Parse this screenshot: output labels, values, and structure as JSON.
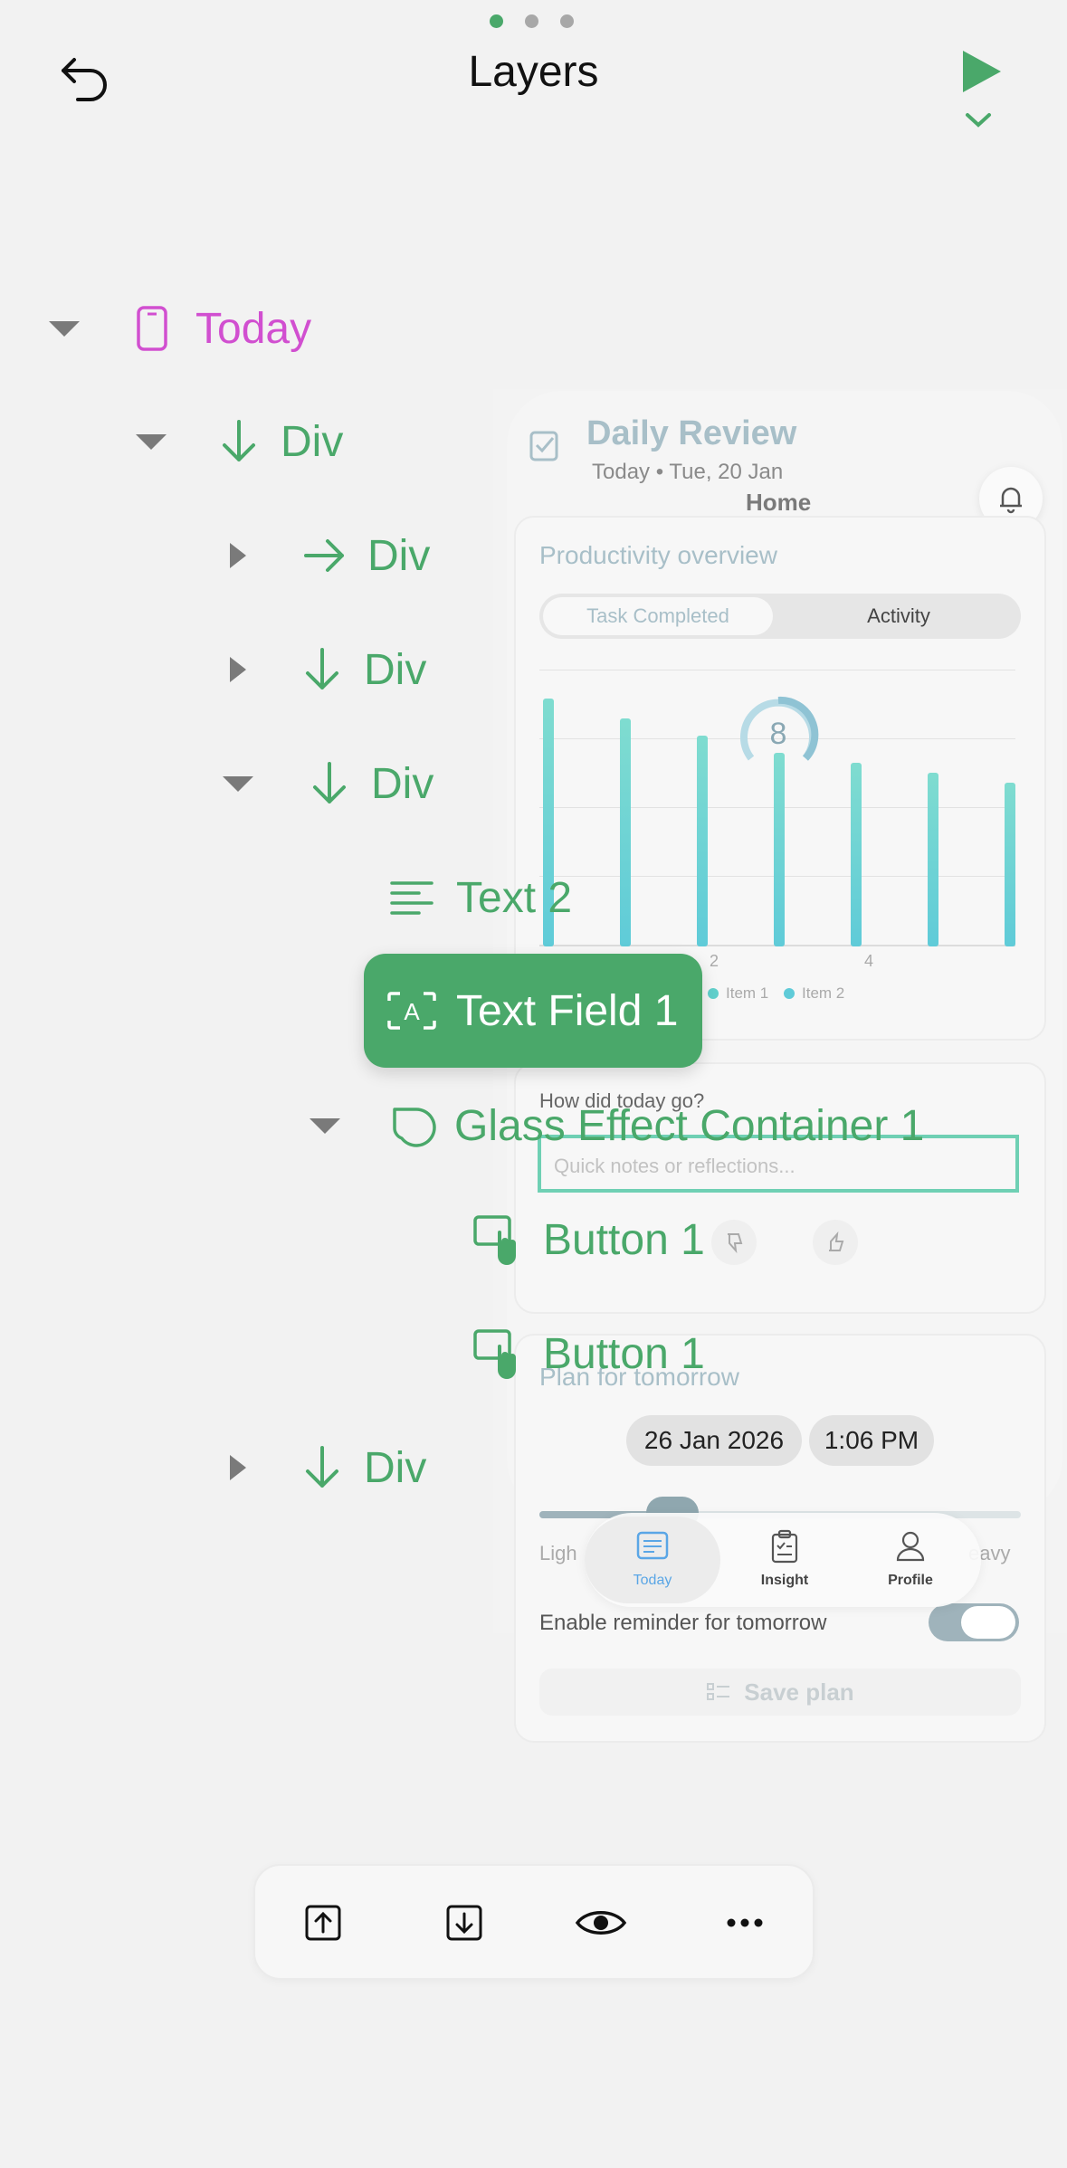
{
  "header": {
    "title": "Layers",
    "page_dots": 3,
    "active_dot": 0
  },
  "tree": {
    "root_label": "Today",
    "items": [
      {
        "label": "Div"
      },
      {
        "label": "Div"
      },
      {
        "label": "Div"
      },
      {
        "label": "Div"
      },
      {
        "label": "Text 2"
      },
      {
        "label": "Text Field 1"
      },
      {
        "label": "Glass Effect Container 1"
      },
      {
        "label": "Button 1"
      },
      {
        "label": "Button 1"
      },
      {
        "label": "Div"
      }
    ]
  },
  "preview": {
    "app_title": "Daily Review",
    "date_line": "Today • Tue, 20 Jan",
    "home_label": "Home",
    "productivity_title": "Productivity overview",
    "seg_tasks": "Task Completed",
    "seg_activity": "Activity",
    "gauge_value": "8",
    "x_tick_1": "2",
    "x_tick_2": "4",
    "legend_1": "Item 1",
    "legend_2": "Item 2",
    "how_did": "How did today go?",
    "notes_placeholder": "Quick notes or reflections...",
    "plan_title": "Plan for tomorrow",
    "date_chip": "26 Jan 2026",
    "time_chip": "1:06 PM",
    "light_label": "Ligh",
    "heavy_label": "eavy",
    "reminder_label": "Enable reminder for tomorrow",
    "save_label": "Save plan",
    "tabs": [
      {
        "label": "Today"
      },
      {
        "label": "Insight"
      },
      {
        "label": "Profile"
      }
    ]
  },
  "chart_data": {
    "type": "bar",
    "categories": [
      "",
      "",
      "",
      "",
      "",
      "",
      ""
    ],
    "values": [
      100,
      92,
      85,
      78,
      74,
      70,
      66
    ],
    "xlabel": "",
    "ylabel": "",
    "series_names": [
      "Item 1",
      "Item 2"
    ]
  },
  "colors": {
    "accent": "#4aa86a",
    "root": "#d14fd0",
    "preview_muted": "#a8bfc8"
  }
}
